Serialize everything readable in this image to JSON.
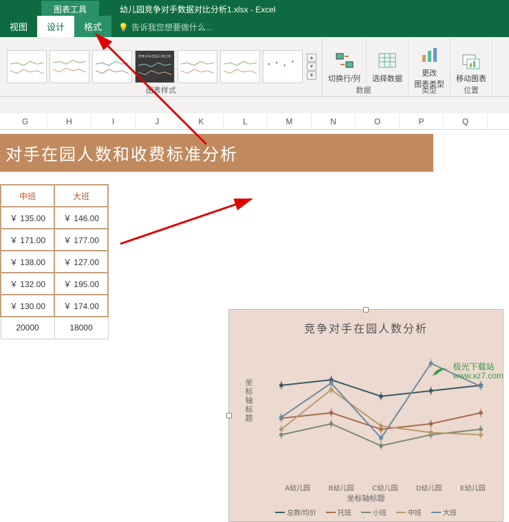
{
  "titlebar": {
    "tool_tab": "图表工具",
    "doc_name": "幼儿园竞争对手数据对比分析1.xlsx - Excel"
  },
  "tabs": {
    "view": "视图",
    "design": "设计",
    "format": "格式",
    "tellme": "告诉我您想要做什么..."
  },
  "ribbon": {
    "styles_label": "图表样式",
    "switch": "切换行/列",
    "select": "选择数据",
    "data_label": "数据",
    "change_type": "更改",
    "change_type2": "图表类型",
    "type_label": "类型",
    "move": "移动图表",
    "location_label": "位置"
  },
  "columns": [
    "G",
    "H",
    "I",
    "J",
    "K",
    "L",
    "M",
    "N",
    "O",
    "P",
    "Q"
  ],
  "banner": "对手在园人数和收费标准分析",
  "table": {
    "headers": [
      "中班",
      "大班"
    ],
    "rows": [
      [
        "￥ 135.00",
        "￥ 146.00"
      ],
      [
        "￥ 171.00",
        "￥ 177.00"
      ],
      [
        "￥ 138.00",
        "￥ 127.00"
      ],
      [
        "￥ 132.00",
        "￥ 195.00"
      ],
      [
        "￥ 130.00",
        "￥ 174.00"
      ]
    ],
    "footer": [
      "20000",
      "18000"
    ]
  },
  "chart": {
    "title": "竞争对手在园人数分析",
    "y_axis": "坐标轴标题",
    "x_axis": "坐标轴标题",
    "categories": [
      "A幼儿园",
      "B幼儿园",
      "C幼儿园",
      "D幼儿园",
      "E幼儿园"
    ],
    "legend": [
      "总数/均价",
      "托班",
      "小班",
      "中班",
      "大班"
    ]
  },
  "chart_data": {
    "type": "line",
    "title": "竞争对手在园人数分析",
    "xlabel": "坐标轴标题",
    "ylabel": "坐标轴标题",
    "categories": [
      "A幼儿园",
      "B幼儿园",
      "C幼儿园",
      "D幼儿园",
      "E幼儿园"
    ],
    "series": [
      {
        "name": "总数/均价",
        "color": "#3a5a66",
        "values": [
          175,
          180,
          165,
          170,
          175
        ]
      },
      {
        "name": "托班",
        "color": "#a86b4c",
        "values": [
          145,
          150,
          135,
          140,
          150
        ]
      },
      {
        "name": "小班",
        "color": "#7a8a7a",
        "values": [
          130,
          140,
          120,
          130,
          135
        ]
      },
      {
        "name": "中班",
        "color": "#b89a6a",
        "values": [
          135,
          171,
          138,
          132,
          130
        ]
      },
      {
        "name": "大班",
        "color": "#6a8aa0",
        "values": [
          146,
          177,
          127,
          195,
          174
        ]
      }
    ],
    "ylim": [
      100,
      200
    ]
  },
  "watermark": "极光下载站\nwww.xz7.com"
}
